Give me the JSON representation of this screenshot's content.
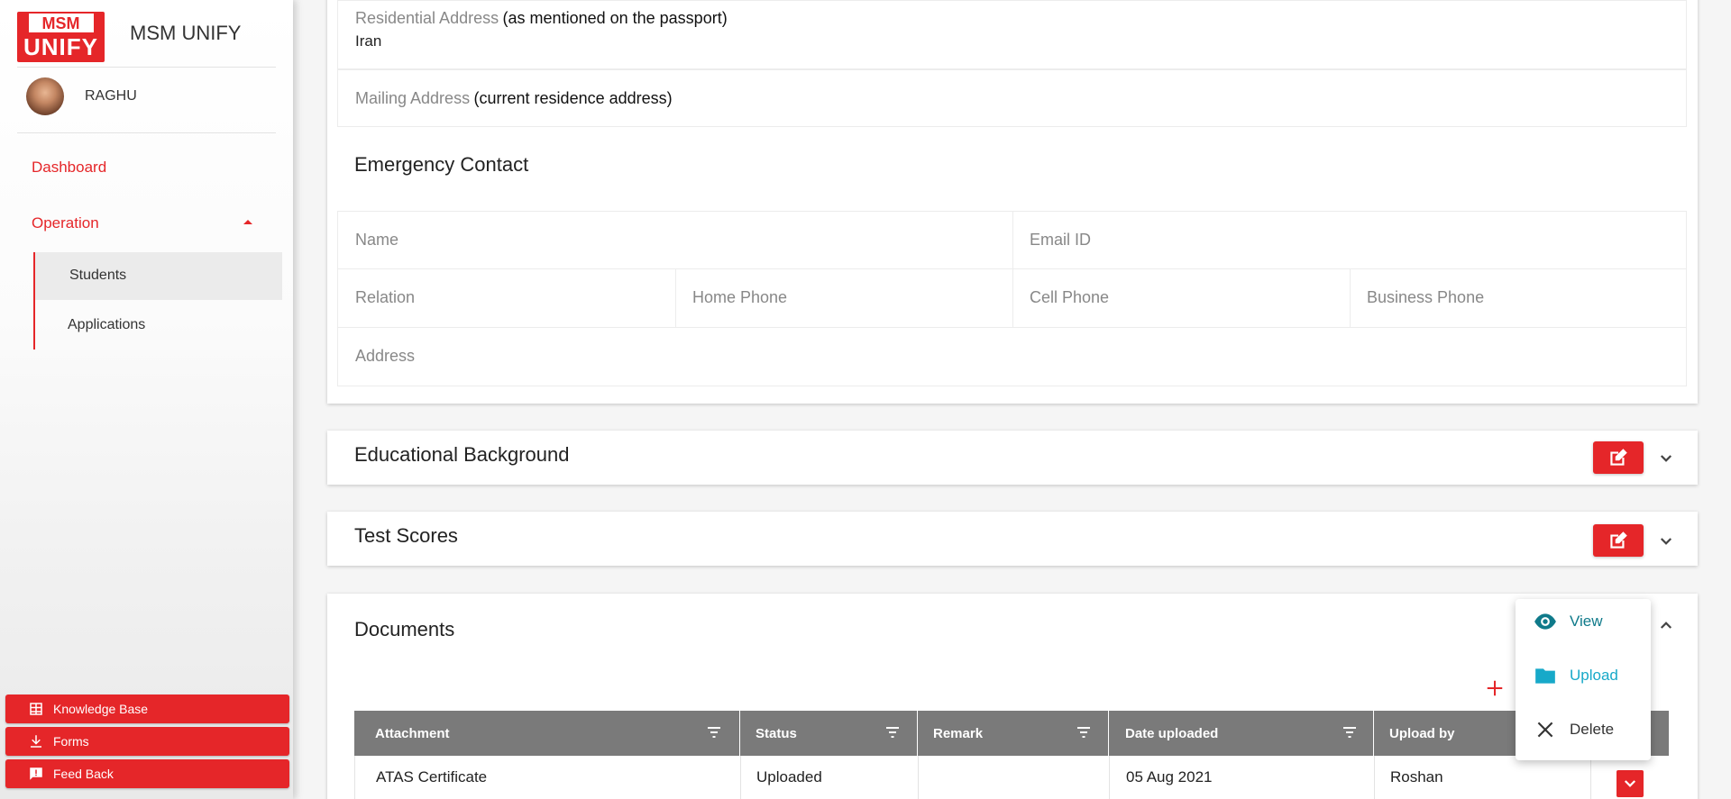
{
  "app": {
    "logo_top": "MSM",
    "logo_bottom": "UNIFY",
    "brand": "MSM UNIFY"
  },
  "user": {
    "name": "RAGHU"
  },
  "nav": {
    "dashboard": "Dashboard",
    "operation": "Operation",
    "students": "Students",
    "applications": "Applications"
  },
  "side_buttons": {
    "knowledge_base": "Knowledge Base",
    "forms": "Forms",
    "feedback": "Feed Back"
  },
  "address": {
    "residential_label": "Residential Address",
    "residential_note": "(as mentioned on the passport)",
    "residential_value": "Iran",
    "mailing_label": "Mailing Address",
    "mailing_note": "(current residence address)"
  },
  "emergency": {
    "title": "Emergency Contact",
    "name": "Name",
    "email": "Email ID",
    "relation": "Relation",
    "home_phone": "Home Phone",
    "cell_phone": "Cell Phone",
    "business_phone": "Business Phone",
    "address": "Address"
  },
  "sections": {
    "education": "Educational Background",
    "test_scores": "Test Scores",
    "documents": "Documents"
  },
  "table": {
    "headers": [
      "Attachment",
      "Status",
      "Remark",
      "Date uploaded",
      "Upload by"
    ],
    "rows": [
      {
        "attachment": "ATAS Certificate",
        "status": "Uploaded",
        "remark": "",
        "date": "05 Aug 2021",
        "upload_by": "Roshan"
      }
    ]
  },
  "menu": {
    "view": "View",
    "upload": "Upload",
    "delete": "Delete"
  },
  "colors": {
    "brand_red": "#e52629",
    "teal": "#0f7a8a",
    "cyan": "#17a9c9",
    "table_header": "#7a7a7a"
  }
}
